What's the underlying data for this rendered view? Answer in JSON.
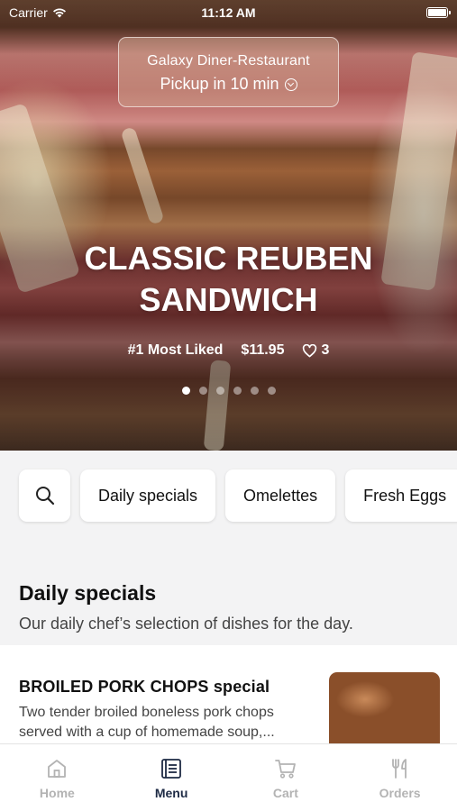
{
  "status_bar": {
    "carrier": "Carrier",
    "time": "11:12 AM"
  },
  "pickup": {
    "restaurant_name": "Galaxy Diner-Restaurant",
    "pickup_time": "Pickup in 10 min"
  },
  "hero": {
    "title_line1": "CLASSIC REUBEN",
    "title_line2": "SANDWICH",
    "rank_label": "#1 Most Liked",
    "price": "$11.95",
    "likes": "3",
    "carousel_count": 6,
    "carousel_active": 1
  },
  "categories": [
    {
      "label": "Daily specials"
    },
    {
      "label": "Omelettes"
    },
    {
      "label": "Fresh Eggs"
    }
  ],
  "section": {
    "title": "Daily specials",
    "subtitle": "Our daily chef’s selection of dishes for the day."
  },
  "items": [
    {
      "name": "BROILED PORK CHOPS special",
      "description": "Two tender broiled boneless pork chops served with a cup of homemade soup,..."
    }
  ],
  "tabs": [
    {
      "label": "Home",
      "icon": "home-icon",
      "active": false
    },
    {
      "label": "Menu",
      "icon": "menu-book-icon",
      "active": true
    },
    {
      "label": "Cart",
      "icon": "cart-icon",
      "active": false
    },
    {
      "label": "Orders",
      "icon": "fork-knife-icon",
      "active": false
    }
  ],
  "colors": {
    "active_tab": "#1d2a44",
    "inactive_tab": "#b3b3b3",
    "background": "#f3f3f4"
  }
}
